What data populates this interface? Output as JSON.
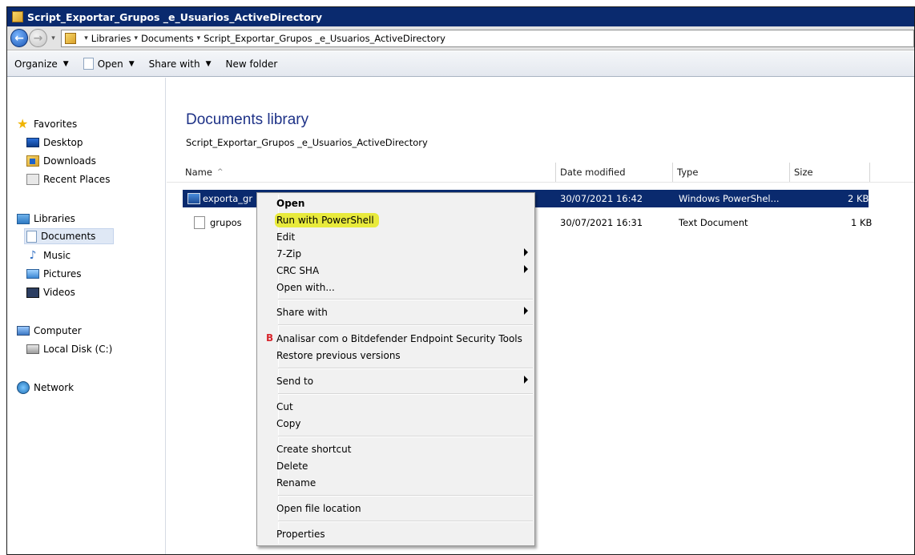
{
  "window": {
    "title": "Script_Exportar_Grupos _e_Usuarios_ActiveDirectory"
  },
  "address": {
    "crumbs": [
      "Libraries",
      "Documents",
      "Script_Exportar_Grupos _e_Usuarios_ActiveDirectory"
    ]
  },
  "toolbar": {
    "organize": "Organize",
    "open": "Open",
    "share_with": "Share with",
    "new_folder": "New folder"
  },
  "sidebar": {
    "favorites": "Favorites",
    "desktop": "Desktop",
    "downloads": "Downloads",
    "recent_places": "Recent Places",
    "libraries": "Libraries",
    "documents": "Documents",
    "music": "Music",
    "pictures": "Pictures",
    "videos": "Videos",
    "computer": "Computer",
    "local_disk": "Local Disk (C:)",
    "network": "Network"
  },
  "library": {
    "title": "Documents library",
    "subtitle": "Script_Exportar_Grupos _e_Usuarios_ActiveDirectory"
  },
  "columns": {
    "name": "Name",
    "sort_indicator": "^",
    "date_modified": "Date modified",
    "type": "Type",
    "size": "Size"
  },
  "files": [
    {
      "name": "exporta_gr",
      "date": "30/07/2021 16:42",
      "type": "Windows PowerShel...",
      "size": "2 KB"
    },
    {
      "name": "grupos",
      "date": "30/07/2021 16:31",
      "type": "Text Document",
      "size": "1 KB"
    }
  ],
  "context_menu": {
    "open": "Open",
    "run_with_powershell": "Run with PowerShell",
    "edit": "Edit",
    "zip": "7-Zip",
    "crc_sha": "CRC SHA",
    "open_with": "Open with...",
    "share_with": "Share with",
    "bitdefender_badge": "B",
    "bitdefender": "Analisar com o Bitdefender Endpoint Security Tools",
    "restore": "Restore previous versions",
    "send_to": "Send to",
    "cut": "Cut",
    "copy": "Copy",
    "create_shortcut": "Create shortcut",
    "delete": "Delete",
    "rename": "Rename",
    "open_file_location": "Open file location",
    "properties": "Properties"
  },
  "colors": {
    "title_bar": "#0a2a6e",
    "selection": "#0a2a6e",
    "highlight": "#e8ea3c"
  }
}
